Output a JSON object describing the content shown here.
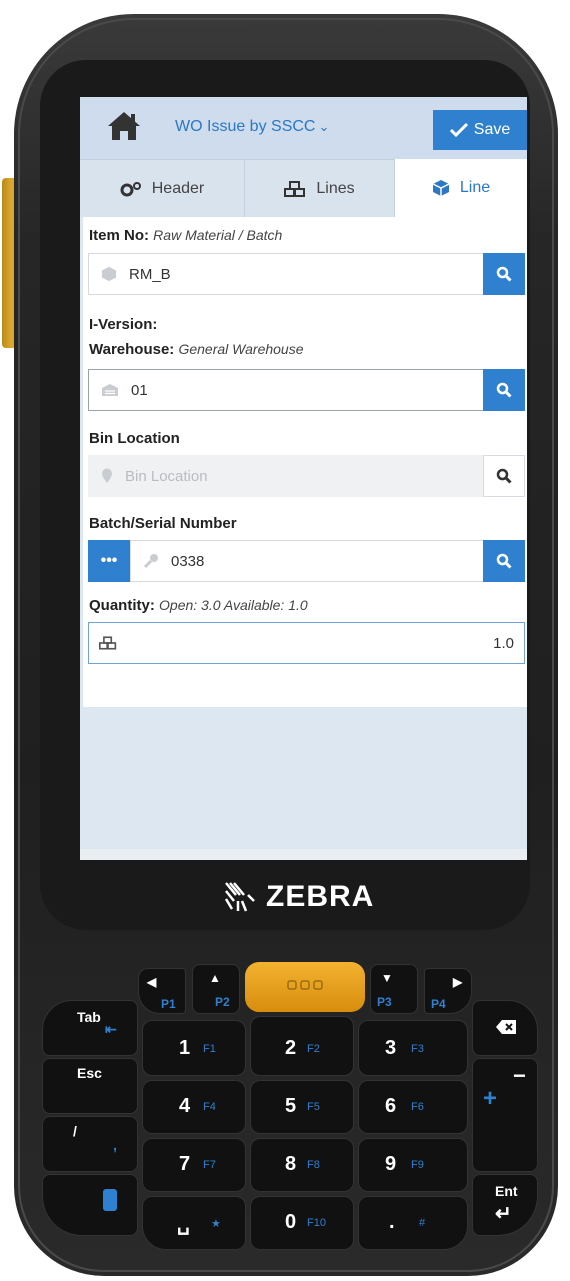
{
  "app": {
    "title": "WO Issue by SSCC",
    "save_label": "Save"
  },
  "tabs": [
    {
      "label": "Header",
      "icon": "gears-icon"
    },
    {
      "label": "Lines",
      "icon": "cubes-icon"
    },
    {
      "label": "Line",
      "icon": "cube-icon",
      "active": true
    }
  ],
  "form": {
    "item_no": {
      "label": "Item No:",
      "hint": "Raw Material / Batch",
      "value": "RM_B"
    },
    "iversion": {
      "label": "I-Version:"
    },
    "warehouse": {
      "label": "Warehouse:",
      "hint": "General Warehouse",
      "value": "01"
    },
    "bin_location": {
      "label": "Bin Location",
      "placeholder": "Bin Location"
    },
    "batch_serial": {
      "label": "Batch/Serial Number",
      "value": "0338"
    },
    "quantity": {
      "label": "Quantity:",
      "hint": "Open: 3.0 Available: 1.0",
      "value": "1.0"
    }
  },
  "device": {
    "brand": "ZEBRA",
    "keys": {
      "p1": "P1",
      "p2": "P2",
      "p3": "P3",
      "p4": "P4",
      "tab": "Tab",
      "esc": "Esc",
      "slash": "/",
      "comma": ",",
      "ent": "Ent",
      "minus": "−",
      "plus": "+",
      "k1": "1",
      "f1": "F1",
      "k2": "2",
      "f2": "F2",
      "k3": "3",
      "f3": "F3",
      "k4": "4",
      "f4": "F4",
      "k5": "5",
      "f5": "F5",
      "k6": "6",
      "f6": "F6",
      "k7": "7",
      "f7": "F7",
      "k8": "8",
      "f8": "F8",
      "k9": "9",
      "f9": "F9",
      "k0": "0",
      "f10": "F10",
      "star": "★",
      "dot": ".",
      "hash": "#"
    }
  },
  "colors": {
    "accent": "#2f80cf",
    "topbar": "#cfdced",
    "background": "#dde7f2",
    "key_orange": "#f3b230"
  }
}
